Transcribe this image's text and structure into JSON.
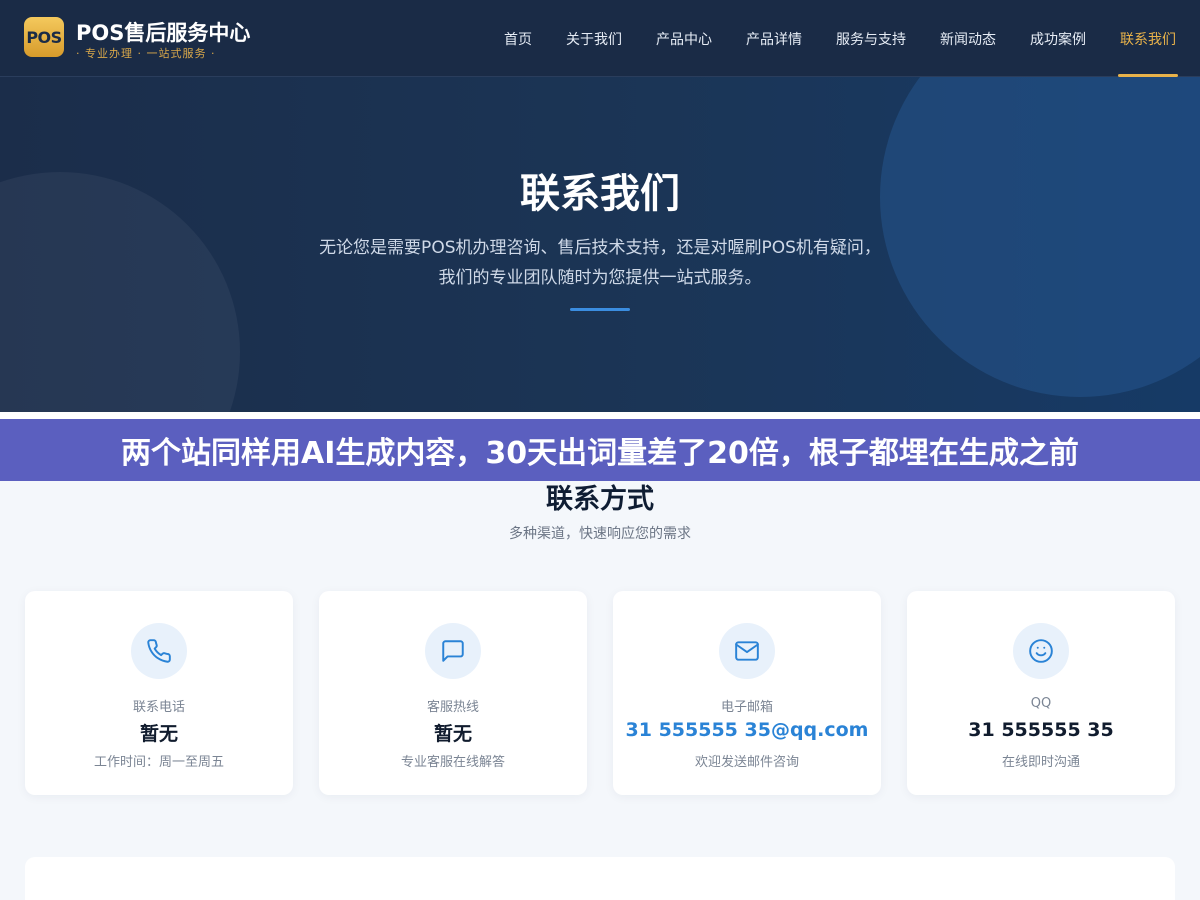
{
  "header": {
    "logo_badge": "POS",
    "logo_title": "POS售后服务中心",
    "logo_sub": "· 专业办理 · 一站式服务 ·",
    "nav": [
      {
        "label": "首页",
        "active": false
      },
      {
        "label": "关于我们",
        "active": false
      },
      {
        "label": "产品中心",
        "active": false
      },
      {
        "label": "产品详情",
        "active": false
      },
      {
        "label": "服务与支持",
        "active": false
      },
      {
        "label": "新闻动态",
        "active": false
      },
      {
        "label": "成功案例",
        "active": false
      },
      {
        "label": "联系我们",
        "active": true
      }
    ]
  },
  "hero": {
    "title": "联系我们",
    "desc_line1": "无论您是需要POS机办理咨询、售后技术支持，还是对喔刷POS机有疑问，",
    "desc_line2": "我们的专业团队随时为您提供一站式服务。"
  },
  "banner": {
    "text": "两个站同样用AI生成内容，30天出词量差了20倍，根子都埋在生成之前"
  },
  "contact": {
    "title": "联系方式",
    "subtitle": "多种渠道，快速响应您的需求",
    "cards": [
      {
        "icon": "phone-icon",
        "label": "联系电话",
        "value": "暂无",
        "note": "工作时间：周一至周五"
      },
      {
        "icon": "chat-icon",
        "label": "客服热线",
        "value": "暂无",
        "note": "专业客服在线解答"
      },
      {
        "icon": "mail-icon",
        "label": "电子邮箱",
        "value": "31 555555 35@qq.com",
        "note": "欢迎发送邮件咨询"
      },
      {
        "icon": "smile-icon",
        "label": "QQ",
        "value": "31 555555 35",
        "note": "在线即时沟通"
      }
    ]
  },
  "colors": {
    "header_bg": "#1a2b46",
    "accent_gold": "#e8b24a",
    "accent_blue": "#2a83d6",
    "banner_bg": "#5b5fbf"
  }
}
